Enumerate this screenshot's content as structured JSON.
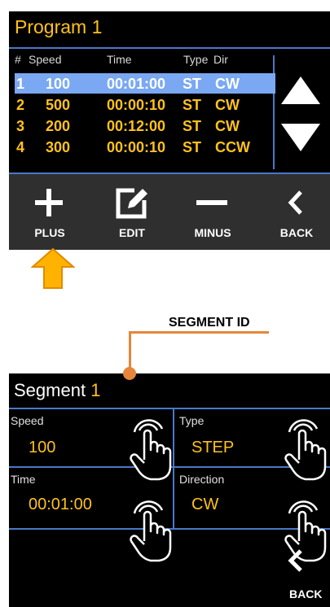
{
  "program": {
    "title": "Program 1",
    "columns": [
      "#",
      "Speed",
      "Time",
      "Type",
      "Dir"
    ],
    "rows": [
      {
        "num": "1",
        "speed": "100",
        "time": "00:01:00",
        "type": "ST",
        "dir": "CW",
        "selected": true
      },
      {
        "num": "2",
        "speed": "500",
        "time": "00:00:10",
        "type": "ST",
        "dir": "CW",
        "selected": false
      },
      {
        "num": "3",
        "speed": "200",
        "time": "00:12:00",
        "type": "ST",
        "dir": "CW",
        "selected": false
      },
      {
        "num": "4",
        "speed": "300",
        "time": "00:00:10",
        "type": "ST",
        "dir": "CCW",
        "selected": false
      }
    ]
  },
  "toolbar": {
    "plus_label": "PLUS",
    "edit_label": "EDIT",
    "minus_label": "MINUS",
    "back_label": "BACK"
  },
  "callout": {
    "label": "SEGMENT ID"
  },
  "segment": {
    "title": "Segment",
    "id": "1",
    "speed_label": "Speed",
    "speed_value": "100",
    "type_label": "Type",
    "type_value": "STEP",
    "time_label": "Time",
    "time_value": "00:01:00",
    "direction_label": "Direction",
    "direction_value": "CW",
    "back_label": "BACK"
  },
  "colors": {
    "accent": "#ffc21a",
    "divider": "#4a78c8",
    "selection": "#7aa8f2",
    "arrow": "#ffb300",
    "callout": "#e5863a"
  },
  "icons": [
    "up-triangle-icon",
    "down-triangle-icon",
    "plus-icon",
    "edit-icon",
    "minus-icon",
    "back-chevron-icon",
    "pointer-arrow-icon",
    "tap-hand-icon"
  ]
}
